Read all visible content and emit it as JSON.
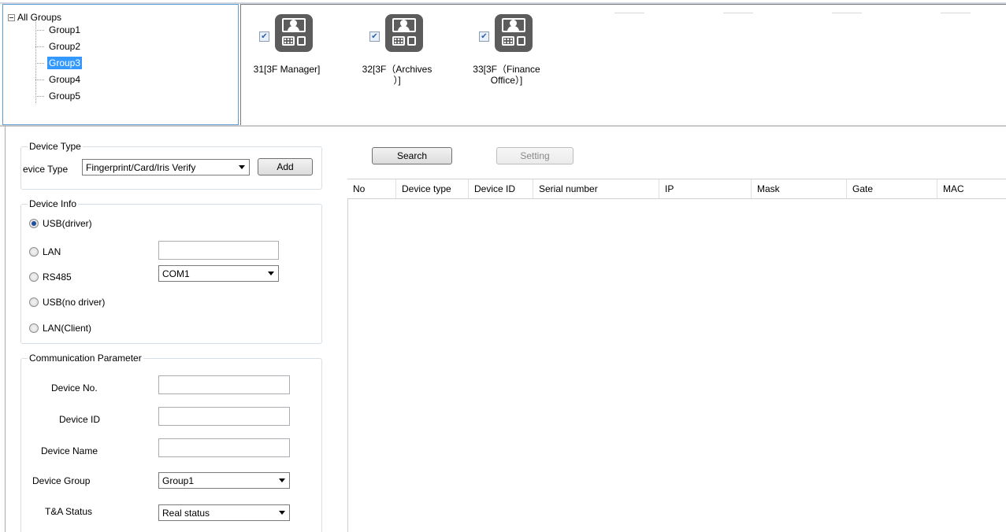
{
  "tree": {
    "root": "All Groups",
    "items": [
      "Group1",
      "Group2",
      "Group3",
      "Group4",
      "Group5"
    ],
    "selected_index": 2
  },
  "devices": [
    {
      "label_line1": "31[3F Manager]",
      "label_line2": "",
      "checked": true,
      "icon": "fingerprint-terminal-icon"
    },
    {
      "label_line1": "32[3F（Archives",
      "label_line2": "）]",
      "checked": true,
      "icon": "fingerprint-terminal-icon"
    },
    {
      "label_line1": "33[3F（Finance",
      "label_line2": "Office）]",
      "checked": true,
      "icon": "fingerprint-terminal-icon"
    }
  ],
  "device_type": {
    "legend": "Device Type",
    "label": "evice Type",
    "selected": "Fingerprint/Card/Iris Verify",
    "add_button": "Add"
  },
  "device_info": {
    "legend": "Device Info",
    "options": [
      "USB(driver)",
      "LAN",
      "RS485",
      "USB(no driver)",
      "LAN(Client)"
    ],
    "selected_option": "USB(driver)",
    "lan_value": "",
    "com_port": "COM1"
  },
  "comm_params": {
    "legend": "Communication Parameter",
    "device_no_label": "Device No.",
    "device_no_value": "",
    "device_id_label": "Device ID",
    "device_id_value": "",
    "device_name_label": "Device Name",
    "device_name_value": "",
    "device_group_label": "Device Group",
    "device_group_value": "Group1",
    "ta_status_label": "T&A Status",
    "ta_status_value": "Real status"
  },
  "toolbar": {
    "search_label": "Search",
    "setting_label": "Setting"
  },
  "table": {
    "columns": [
      "No",
      "Device type",
      "Device ID",
      "Serial number",
      "IP",
      "Mask",
      "Gate",
      "MAC"
    ],
    "rows": []
  },
  "colors": {
    "selection": "#3399ff",
    "panel_border": "#5b9bd5",
    "icon_fill": "#5c5c5c"
  }
}
